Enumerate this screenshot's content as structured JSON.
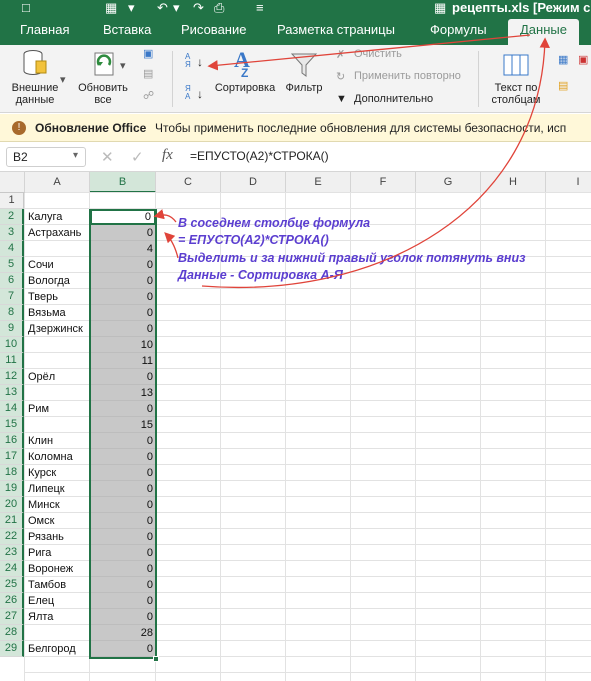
{
  "window": {
    "title": "рецепты.xls  [Режим с"
  },
  "tabs": [
    {
      "label": "Главная",
      "active": false
    },
    {
      "label": "Вставка",
      "active": false
    },
    {
      "label": "Рисование",
      "active": false
    },
    {
      "label": "Разметка страницы",
      "active": false
    },
    {
      "label": "Формулы",
      "active": false
    },
    {
      "label": "Данные",
      "active": true
    }
  ],
  "ribbon": {
    "external_data": "Внешние\nданные",
    "refresh_all": "Обновить\nвсе",
    "sort": "Сортировка",
    "filter": "Фильтр",
    "clear": "Очистить",
    "reapply": "Применить повторно",
    "advanced": "Дополнительно",
    "text_to_columns": "Текст по\nстолбцам",
    "sort_az_icon_text": "А\nЯ",
    "sort_za_icon_text": "Я\nА"
  },
  "message_bar": {
    "title": "Обновление Office",
    "text": "Чтобы применить последние обновления для системы безопасности, исп"
  },
  "formula_bar": {
    "name_box": "B2",
    "fx": "fx",
    "formula": "=ЕПУСТО(A2)*СТРОКА()"
  },
  "columns": [
    "A",
    "B",
    "C",
    "D",
    "E",
    "F",
    "G",
    "H",
    "I"
  ],
  "rows": [
    {
      "n": "1",
      "a": "",
      "b": ""
    },
    {
      "n": "2",
      "a": "Калуга",
      "b": "0"
    },
    {
      "n": "3",
      "a": "Астрахань",
      "b": "0"
    },
    {
      "n": "4",
      "a": "",
      "b": "4"
    },
    {
      "n": "5",
      "a": "Сочи",
      "b": "0"
    },
    {
      "n": "6",
      "a": "Вологда",
      "b": "0"
    },
    {
      "n": "7",
      "a": "Тверь",
      "b": "0"
    },
    {
      "n": "8",
      "a": "Вязьма",
      "b": "0"
    },
    {
      "n": "9",
      "a": "Дзержинск",
      "b": "0"
    },
    {
      "n": "10",
      "a": "",
      "b": "10"
    },
    {
      "n": "11",
      "a": "",
      "b": "11"
    },
    {
      "n": "12",
      "a": "Орёл",
      "b": "0"
    },
    {
      "n": "13",
      "a": "",
      "b": "13"
    },
    {
      "n": "14",
      "a": "Рим",
      "b": "0"
    },
    {
      "n": "15",
      "a": "",
      "b": "15"
    },
    {
      "n": "16",
      "a": "Клин",
      "b": "0"
    },
    {
      "n": "17",
      "a": "Коломна",
      "b": "0"
    },
    {
      "n": "18",
      "a": "Курск",
      "b": "0"
    },
    {
      "n": "19",
      "a": "Липецк",
      "b": "0"
    },
    {
      "n": "20",
      "a": "Минск",
      "b": "0"
    },
    {
      "n": "21",
      "a": "Омск",
      "b": "0"
    },
    {
      "n": "22",
      "a": "Рязань",
      "b": "0"
    },
    {
      "n": "23",
      "a": "Рига",
      "b": "0"
    },
    {
      "n": "24",
      "a": "Воронеж",
      "b": "0"
    },
    {
      "n": "25",
      "a": "Тамбов",
      "b": "0"
    },
    {
      "n": "26",
      "a": "Елец",
      "b": "0"
    },
    {
      "n": "27",
      "a": "Ялта",
      "b": "0"
    },
    {
      "n": "28",
      "a": "",
      "b": "28"
    },
    {
      "n": "29",
      "a": "Белгород",
      "b": "0"
    }
  ],
  "annotation": {
    "line1": "В соседнем столбце формула",
    "line2": "= ЕПУСТО(A2)*СТРОКА()",
    "line3": "Выделить и за нижний правый уголок потянуть вниз",
    "line4": "Данные - Сортировка А-Я"
  },
  "colors": {
    "excel_green": "#217346",
    "annotation": "#5b3ed0",
    "arrow": "#e0443a",
    "selection_fill": "#c8c8c8"
  }
}
